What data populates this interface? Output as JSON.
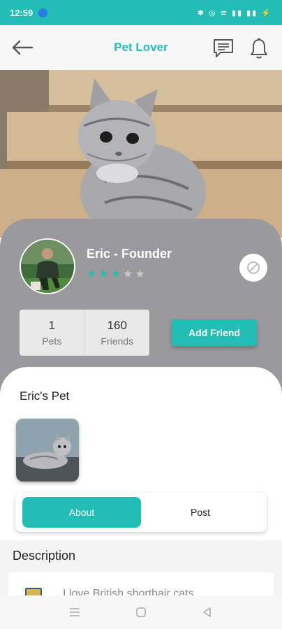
{
  "status_bar": {
    "time": "12:59",
    "icons": "✱ ◎ ≋ ▮▮ ▮▮ ⚡"
  },
  "app_bar": {
    "title": "Pet Lover",
    "back_icon": "arrow-left-icon",
    "chat_icon": "chat-icon",
    "bell_icon": "bell-icon"
  },
  "profile": {
    "name": "Eric - Founder",
    "rating": 3,
    "rating_max": 5,
    "pets_count": "1",
    "pets_label": "Pets",
    "friends_count": "160",
    "friends_label": "Friends",
    "add_friend_label": "Add Friend"
  },
  "pet_section": {
    "title": "Eric's Pet"
  },
  "tabs": [
    {
      "label": "About",
      "active": true
    },
    {
      "label": "Post",
      "active": false
    }
  ],
  "description": {
    "title": "Description",
    "text": "I love British shorthair cats"
  },
  "colors": {
    "accent": "#22bdb5",
    "card": "#9a9a9c",
    "star_on": "#22bdb5",
    "star_off": "#c8c8c8"
  }
}
